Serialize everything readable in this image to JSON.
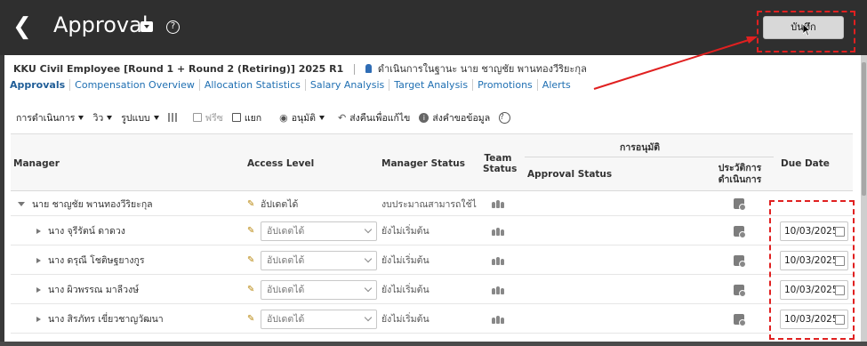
{
  "header": {
    "title": "Approval",
    "save_label": "บันทึก"
  },
  "context": {
    "plan": "KKU Civil Employee [Round 1 + Round 2 (Retiring)] 2025 R1",
    "acting_as": "ดำเนินการในฐานะ นาย ชาญชัย พานทองวีริยะกุล"
  },
  "tabs": [
    {
      "label": "Approvals",
      "active": true
    },
    {
      "label": "Compensation Overview"
    },
    {
      "label": "Allocation Statistics"
    },
    {
      "label": "Salary Analysis"
    },
    {
      "label": "Target Analysis"
    },
    {
      "label": "Promotions"
    },
    {
      "label": "Alerts"
    }
  ],
  "toolbar": {
    "actions": "การดำเนินการ",
    "view": "วิว",
    "format": "รูปแบบ",
    "freeze": "ฟรีซ",
    "detach": "แยก",
    "approve": "อนุมัติ",
    "return_for_correction": "ส่งคืนเพื่อแก้ไข",
    "request_info": "ส่งคำขอข้อมูล"
  },
  "table": {
    "headers": {
      "manager": "Manager",
      "access_level": "Access Level",
      "manager_status": "Manager Status",
      "team_status": "Team Status",
      "approval_group": "การอนุมัติ",
      "approval_status": "Approval Status",
      "action_history": "ประวัติการดำเนินการ",
      "due_date": "Due Date"
    },
    "rows": [
      {
        "manager": "นาย ชาญชัย พานทองวีริยะกุล",
        "access_level": "อัปเดตได้",
        "manager_status": "งบประมาณสามารถใช้ไ",
        "due_date": ""
      },
      {
        "manager": "นาง จุรีรัตน์ ดาดวง",
        "access_level": "อัปเดตได้",
        "manager_status": "ยังไม่เริ่มต้น",
        "due_date": "10/03/2025"
      },
      {
        "manager": "นาง ดรุณี โชติษฐยางกูร",
        "access_level": "อัปเดตได้",
        "manager_status": "ยังไม่เริ่มต้น",
        "due_date": "10/03/2025"
      },
      {
        "manager": "นาง ผิวพรรณ มาลีวงษ์",
        "access_level": "อัปเดตได้",
        "manager_status": "ยังไม่เริ่มต้น",
        "due_date": "10/03/2025"
      },
      {
        "manager": "นาง สิรภัทร เขี่ยวชาญวัฒนา",
        "access_level": "อัปเดตได้",
        "manager_status": "ยังไม่เริ่มต้น",
        "due_date": "10/03/2025"
      }
    ]
  },
  "colors": {
    "header_bg": "#2f2f2f",
    "link": "#1f6fb2",
    "annotation": "#e02020"
  }
}
